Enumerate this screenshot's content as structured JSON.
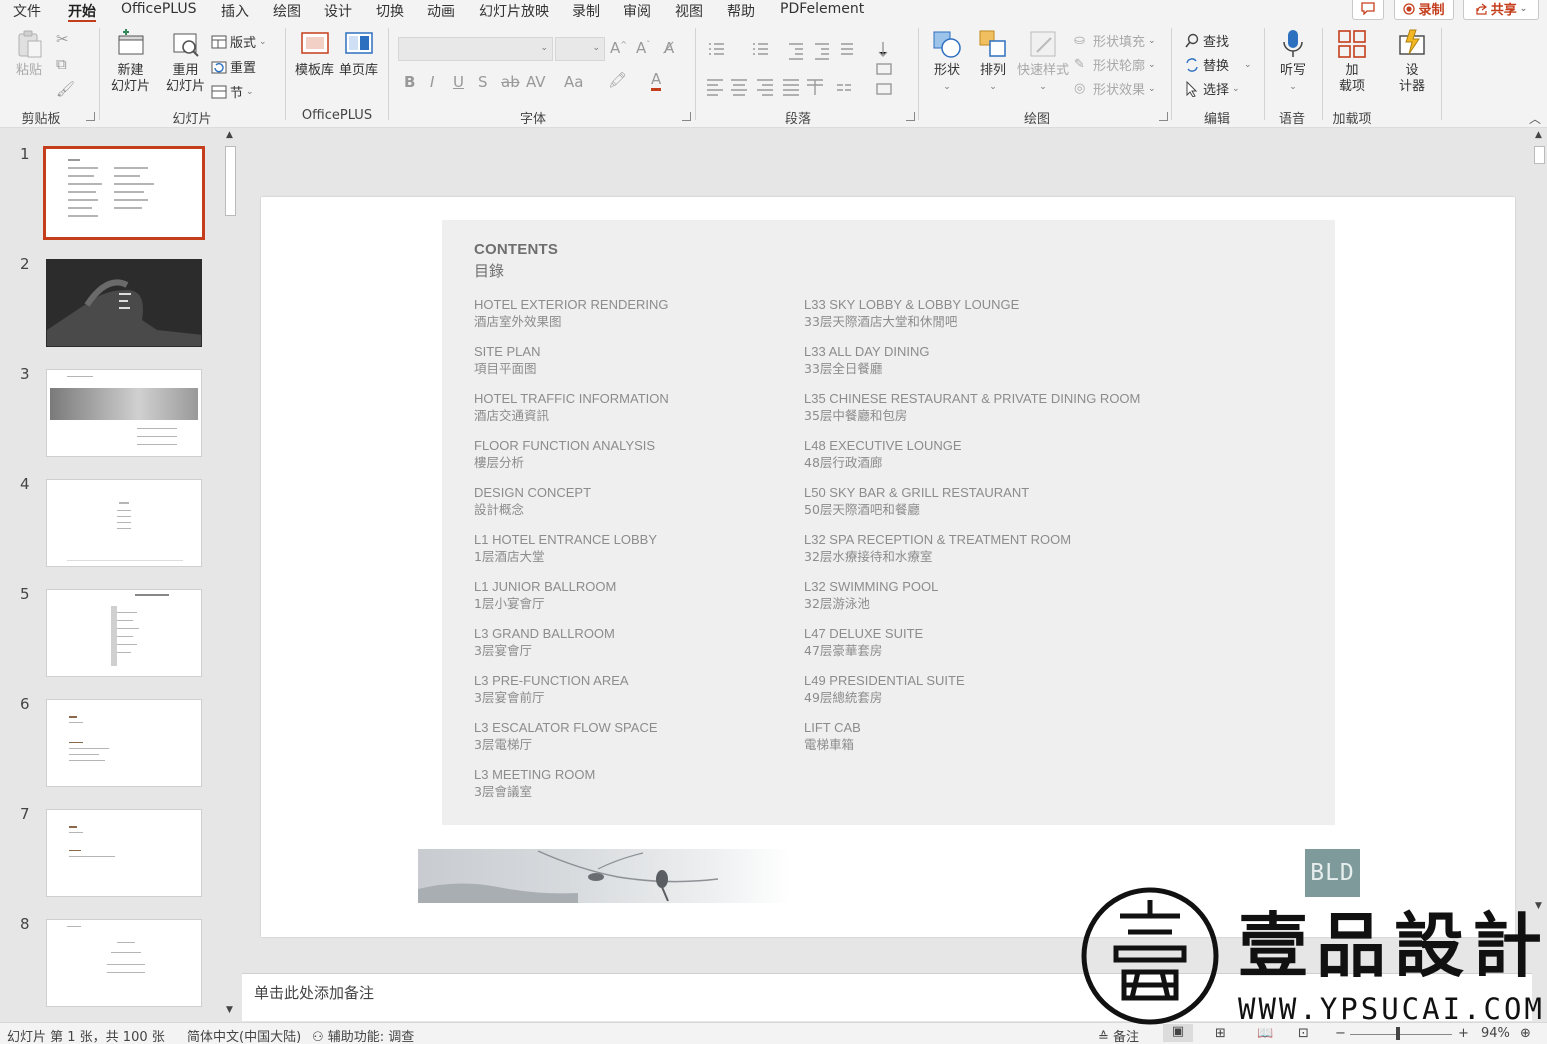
{
  "menu": {
    "items": [
      "文件",
      "开始",
      "OfficePLUS",
      "插入",
      "绘图",
      "设计",
      "切换",
      "动画",
      "幻灯片放映",
      "录制",
      "审阅",
      "视图",
      "帮助",
      "PDFelement"
    ],
    "active_index": 1,
    "record_button": "录制",
    "share_button": "共享",
    "accent_color": "#c43e1c"
  },
  "ribbon": {
    "clipboard": {
      "label": "剪贴板",
      "paste": "粘贴"
    },
    "slides": {
      "label": "幻灯片",
      "new_slide_1": "新建",
      "new_slide_2": "幻灯片",
      "reuse_1": "重用",
      "reuse_2": "幻灯片",
      "layout": "版式",
      "reset": "重置",
      "section": "节"
    },
    "officeplus": {
      "label": "OfficePLUS",
      "template_lib": "模板库",
      "single_page_lib": "单页库"
    },
    "font": {
      "label": "字体",
      "bold": "B",
      "italic": "I",
      "underline": "U",
      "shadow": "S",
      "strike": "ab",
      "spacing": "AV",
      "case": "Aa",
      "font_color": "A"
    },
    "paragraph": {
      "label": "段落"
    },
    "drawing": {
      "label": "绘图",
      "shapes": "形状",
      "arrange": "排列",
      "quick_styles": "快速样式",
      "shape_fill": "形状填充",
      "shape_outline": "形状轮廓",
      "shape_effects": "形状效果"
    },
    "editing": {
      "label": "编辑",
      "find": "查找",
      "replace": "替换",
      "select": "选择"
    },
    "voice": {
      "label": "语音",
      "dictate": "听写"
    },
    "addins": {
      "label": "加载项",
      "addins_1": "加",
      "addins_2": "载项",
      "designer_1": "设",
      "designer_2": "计器"
    }
  },
  "thumbnails": [
    {
      "num": "1",
      "selected": true
    },
    {
      "num": "2",
      "selected": false
    },
    {
      "num": "3",
      "selected": false
    },
    {
      "num": "4",
      "selected": false
    },
    {
      "num": "5",
      "selected": false
    },
    {
      "num": "6",
      "selected": false
    },
    {
      "num": "7",
      "selected": false
    },
    {
      "num": "8",
      "selected": false
    }
  ],
  "slide": {
    "title_en": "CONTENTS",
    "title_zh": "目錄",
    "left_column": [
      {
        "en": "HOTEL EXTERIOR RENDERING",
        "zh": "酒店室外效果图"
      },
      {
        "en": "SITE PLAN",
        "zh": "項目平面图"
      },
      {
        "en": "HOTEL TRAFFIC INFORMATION",
        "zh": "酒店交通資訊"
      },
      {
        "en": "FLOOR FUNCTION ANALYSIS",
        "zh": "樓层分析"
      },
      {
        "en": "DESIGN CONCEPT",
        "zh": "設計概念"
      },
      {
        "en": "L1 HOTEL ENTRANCE LOBBY",
        "zh": "1层酒店大堂"
      },
      {
        "en": "L1 JUNIOR BALLROOM",
        "zh": "1层小宴會厅"
      },
      {
        "en": "L3 GRAND BALLROOM",
        "zh": "3层宴會厅"
      },
      {
        "en": "L3 PRE-FUNCTION AREA",
        "zh": "3层宴會前厅"
      },
      {
        "en": "L3 ESCALATOR FLOW SPACE",
        "zh": "3层電梯厅"
      },
      {
        "en": "L3 MEETING ROOM",
        "zh": "3层會議室"
      }
    ],
    "right_column": [
      {
        "en": "L33 SKY LOBBY & LOBBY LOUNGE",
        "zh": "33层天際酒店大堂和休閒吧"
      },
      {
        "en": "L33 ALL DAY DINING",
        "zh": "33层全日餐廳"
      },
      {
        "en": "L35 CHINESE RESTAURANT & PRIVATE DINING ROOM",
        "zh": "35层中餐廳和包房"
      },
      {
        "en": "L48 EXECUTIVE LOUNGE",
        "zh": "48层行政酒廊"
      },
      {
        "en": "L50 SKY BAR & GRILL RESTAURANT",
        "zh": "50层天際酒吧和餐廳"
      },
      {
        "en": "L32 SPA RECEPTION & TREATMENT ROOM",
        "zh": "32层水療接待和水療室"
      },
      {
        "en": "L32 SWIMMING POOL",
        "zh": "32层游泳池"
      },
      {
        "en": "L47 DELUXE SUITE",
        "zh": "47层豪華套房"
      },
      {
        "en": "L49 PRESIDENTIAL SUITE",
        "zh": "49层總統套房"
      },
      {
        "en": "LIFT CAB",
        "zh": "電梯車箱"
      }
    ],
    "logo_text": "BLD"
  },
  "notes_placeholder": "单击此处添加备注",
  "status": {
    "slide_info": "幻灯片 第 1 张，共 100 张",
    "language": "简体中文(中国大陆)",
    "accessibility": "辅助功能: 调查",
    "notes_button": "备注",
    "zoom": "94%"
  },
  "watermark": {
    "title": "壹品設計",
    "url": "WWW.YPSUCAI.COM"
  }
}
